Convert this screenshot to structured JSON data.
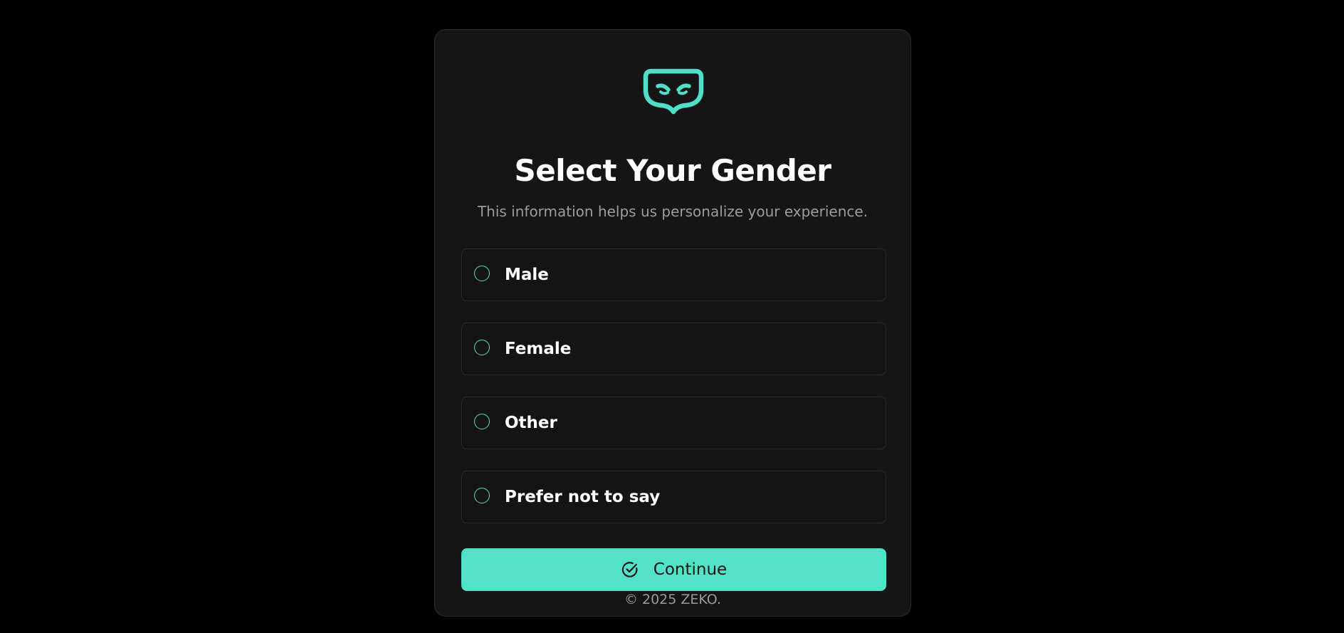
{
  "brand": {
    "logo_icon": "mask-icon",
    "accent_color": "#52e2c8"
  },
  "header": {
    "title": "Select Your Gender",
    "subtitle": "This information helps us personalize your experience."
  },
  "options": [
    {
      "label": "Male",
      "selected": false
    },
    {
      "label": "Female",
      "selected": false
    },
    {
      "label": "Other",
      "selected": false
    },
    {
      "label": "Prefer not to say",
      "selected": false
    }
  ],
  "actions": {
    "continue_label": "Continue",
    "continue_icon": "check-circle-icon"
  },
  "footer": {
    "copyright": "© 2025 ZEKO."
  }
}
